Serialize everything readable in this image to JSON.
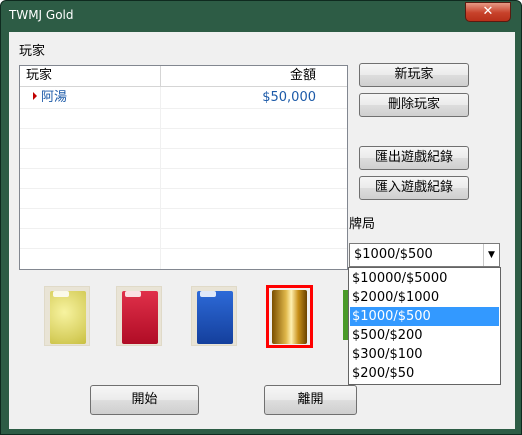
{
  "window": {
    "title": "TWMJ Gold",
    "close_label": "✕"
  },
  "players_label": "玩家",
  "table": {
    "headers": [
      "玩家",
      "金額"
    ],
    "rows": [
      {
        "name": "阿湯",
        "money": "$50,000"
      }
    ]
  },
  "buttons": {
    "new_player": "新玩家",
    "delete_player": "刪除玩家",
    "export_log": "匯出遊戲紀錄",
    "import_log": "匯入遊戲紀錄",
    "start": "開始",
    "leave": "離開"
  },
  "stakes_label": "牌局",
  "stakes": {
    "selected": "$1000/$500",
    "options": [
      "$10000/$5000",
      "$2000/$1000",
      "$1000/$500",
      "$500/$200",
      "$300/$100",
      "$200/$50"
    ],
    "highlighted_index": 2
  },
  "tiles": [
    {
      "name": "yellow-tile-back",
      "color": "#e6e070"
    },
    {
      "name": "red-tile-back",
      "color": "#c0102a"
    },
    {
      "name": "blue-tile-back",
      "color": "#1a4fb8"
    },
    {
      "name": "gold-tile-back",
      "color": "#b8860b",
      "selected": true
    },
    {
      "name": "green-tile-back",
      "color": "#4a9a2a"
    }
  ],
  "colors": {
    "window_frame": "#2d5c45",
    "accent_text": "#1c5aa8",
    "selection": "#3399ff",
    "selected_frame": "#ff0000"
  }
}
